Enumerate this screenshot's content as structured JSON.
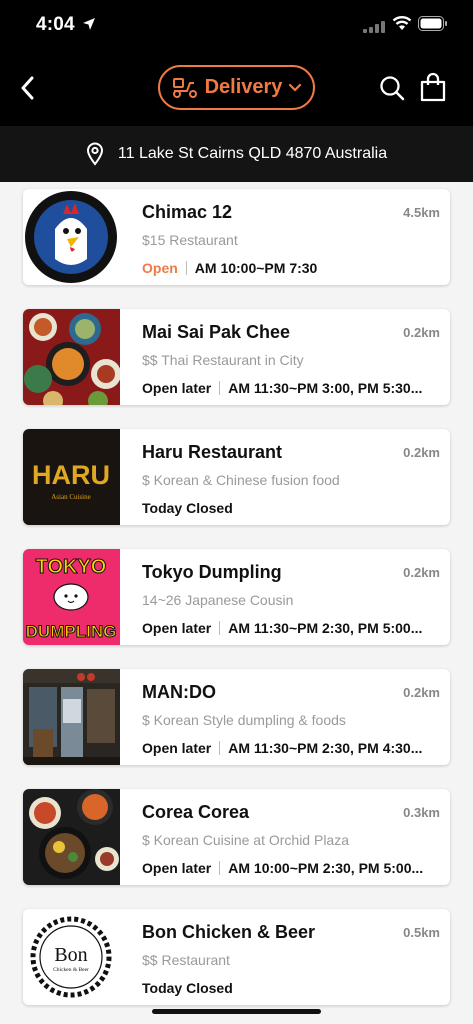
{
  "status_bar": {
    "time": "4:04"
  },
  "nav": {
    "back_icon": "chevron-left-icon",
    "mode_label": "Delivery",
    "mode_icon": "scooter-icon",
    "search_icon": "search-icon",
    "cart_icon": "shopping-bag-icon"
  },
  "address": {
    "text": "11 Lake St Cairns QLD 4870 Australia",
    "icon": "map-pin-icon"
  },
  "colors": {
    "accent": "#f07a45",
    "header_bg": "#000000",
    "address_bg": "#141414"
  },
  "restaurants": [
    {
      "name": "Chimac 12",
      "distance": "4.5km",
      "category": "$15 Restaurant",
      "status": "Open",
      "hours": "AM 10:00~PM 7:30",
      "thumb": "chimac-logo"
    },
    {
      "name": "Mai Sai Pak Chee",
      "distance": "0.2km",
      "category": "$$ Thai Restaurant in City",
      "status": "Open later",
      "hours": "AM 11:30~PM 3:00, PM 5:30...",
      "thumb": "thai-food-photo"
    },
    {
      "name": "Haru Restaurant",
      "distance": "0.2km",
      "category": "$ Korean & Chinese fusion food",
      "status": "Today Closed",
      "hours": "",
      "thumb": "haru-logo",
      "logo_text": "HARU",
      "logo_sub": "Asian Cuisine"
    },
    {
      "name": "Tokyo Dumpling",
      "distance": "0.2km",
      "category": "14~26 Japanese Cousin",
      "status": "Open later",
      "hours": "AM 11:30~PM 2:30, PM 5:00...",
      "thumb": "tokyo-dumpling-logo",
      "logo_top": "TOKYO",
      "logo_bottom": "DUMPLING"
    },
    {
      "name": "MAN:DO",
      "distance": "0.2km",
      "category": "$ Korean Style dumpling & foods",
      "status": "Open later",
      "hours": "AM 11:30~PM 2:30, PM 4:30...",
      "thumb": "storefront-photo"
    },
    {
      "name": "Corea Corea",
      "distance": "0.3km",
      "category": "$ Korean Cuisine at Orchid Plaza",
      "status": "Open later",
      "hours": "AM 10:00~PM 2:30, PM 5:00...",
      "thumb": "korean-food-photo"
    },
    {
      "name": "Bon Chicken & Beer",
      "distance": "0.5km",
      "category": "$$ Restaurant",
      "status": "Today Closed",
      "hours": "",
      "thumb": "bon-logo",
      "logo_text": "Bon",
      "logo_sub": "Chicken & Beer"
    }
  ]
}
